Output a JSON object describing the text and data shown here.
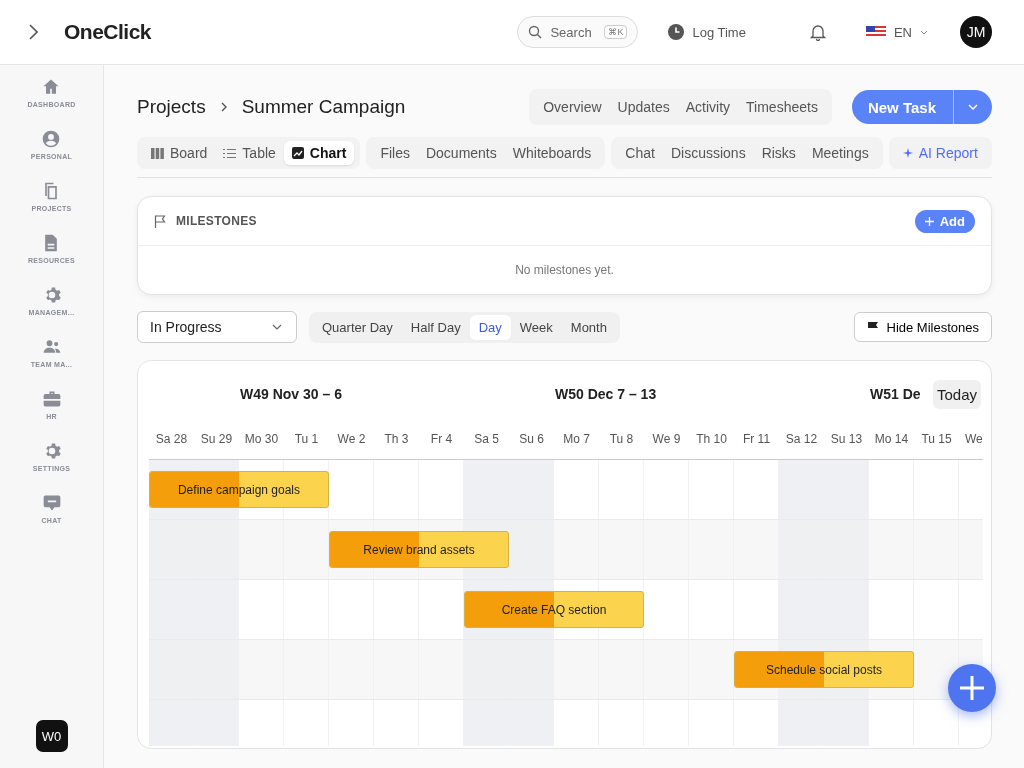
{
  "header": {
    "brand": "OneClick",
    "search": {
      "placeholder": "Search",
      "shortcut": "⌘K"
    },
    "log_time": "Log Time",
    "language": "EN",
    "avatar": "JM"
  },
  "sidebar": {
    "items": [
      {
        "label": "DASHBOARD"
      },
      {
        "label": "PERSONAL"
      },
      {
        "label": "PROJECTS"
      },
      {
        "label": "RESOURCES"
      },
      {
        "label": "MANAGEM..."
      },
      {
        "label": "TEAM MA..."
      },
      {
        "label": "HR"
      },
      {
        "label": "SETTINGS"
      },
      {
        "label": "CHAT"
      }
    ],
    "workspace": "W0"
  },
  "breadcrumb": [
    "Projects",
    "Summer Campaign"
  ],
  "top_tabs": [
    "Overview",
    "Updates",
    "Activity",
    "Timesheets"
  ],
  "new_task": "New Task",
  "view_tabs": [
    [
      {
        "label": "Board",
        "selected": false
      },
      {
        "label": "Table",
        "selected": false
      },
      {
        "label": "Chart",
        "selected": true
      }
    ],
    [
      {
        "label": "Files",
        "selected": false
      },
      {
        "label": "Documents",
        "selected": false
      },
      {
        "label": "Whiteboards",
        "selected": false
      }
    ],
    [
      {
        "label": "Chat",
        "selected": false
      },
      {
        "label": "Discussions",
        "selected": false
      },
      {
        "label": "Risks",
        "selected": false
      },
      {
        "label": "Meetings",
        "selected": false
      }
    ],
    [
      {
        "label": "AI Report",
        "selected": false
      }
    ]
  ],
  "milestones": {
    "title": "MILESTONES",
    "add": "Add",
    "empty": "No milestones yet."
  },
  "filter": {
    "value": "In Progress"
  },
  "scales": [
    {
      "label": "Quarter Day",
      "selected": false
    },
    {
      "label": "Half Day",
      "selected": false
    },
    {
      "label": "Day",
      "selected": true
    },
    {
      "label": "Week",
      "selected": false
    },
    {
      "label": "Month",
      "selected": false
    }
  ],
  "hide_milestones": "Hide Milestones",
  "gantt": {
    "weeks": [
      "W49 Nov 30 – 6",
      "W50 Dec 7 – 13",
      "W51 De"
    ],
    "today": "Today",
    "days": [
      {
        "label": "Sa 28",
        "weekend": true
      },
      {
        "label": "Su 29",
        "weekend": true
      },
      {
        "label": "Mo 30",
        "weekend": false
      },
      {
        "label": "Tu 1",
        "weekend": false
      },
      {
        "label": "We 2",
        "weekend": false
      },
      {
        "label": "Th 3",
        "weekend": false
      },
      {
        "label": "Fr 4",
        "weekend": false
      },
      {
        "label": "Sa 5",
        "weekend": true
      },
      {
        "label": "Su 6",
        "weekend": true
      },
      {
        "label": "Mo 7",
        "weekend": false
      },
      {
        "label": "Tu 8",
        "weekend": false
      },
      {
        "label": "We 9",
        "weekend": false
      },
      {
        "label": "Th 10",
        "weekend": false
      },
      {
        "label": "Fr 11",
        "weekend": false
      },
      {
        "label": "Sa 12",
        "weekend": true
      },
      {
        "label": "Su 13",
        "weekend": true
      },
      {
        "label": "Mo 14",
        "weekend": false
      },
      {
        "label": "Tu 15",
        "weekend": false
      },
      {
        "label": "We",
        "weekend": false
      }
    ],
    "tasks": [
      {
        "name": "Define campaign goals",
        "level": 0.5
      },
      {
        "name": "Review brand assets",
        "level": 0.5
      },
      {
        "name": "Create FAQ section",
        "level": 0.5
      },
      {
        "name": "Schedule social posts",
        "level": 0.5
      }
    ]
  }
}
